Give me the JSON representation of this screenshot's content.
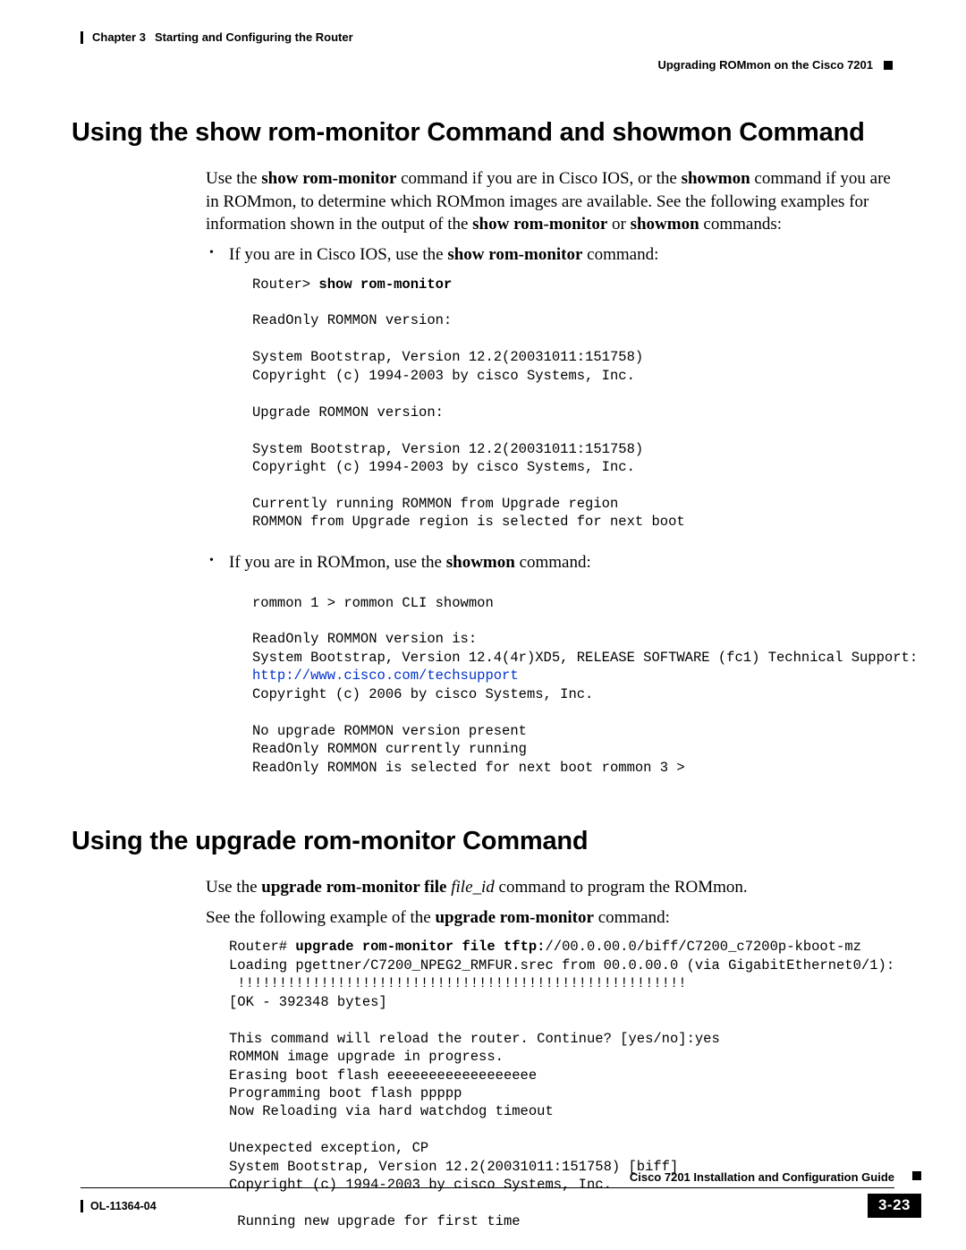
{
  "header": {
    "chapter_label": "Chapter 3",
    "chapter_title": "Starting and Configuring the Router",
    "section_right": "Upgrading ROMmon on the Cisco 7201"
  },
  "section1": {
    "title": "Using the show rom-monitor Command and showmon Command",
    "intro_pre": "Use the ",
    "intro_cmd1": "show rom-monitor",
    "intro_mid1": " command if you are in Cisco IOS, or the ",
    "intro_cmd2": "showmon",
    "intro_mid2": " command if you are in ROMmon, to determine which ROMmon images are available. See the following examples for information shown in the output of the ",
    "intro_cmd3": "show rom-monitor",
    "intro_mid3": " or ",
    "intro_cmd4": "showmon",
    "intro_tail": " commands:",
    "bullet1_pre": "If you are in Cisco IOS, use the ",
    "bullet1_cmd": "show rom-monitor",
    "bullet1_tail": " command:",
    "code1_prompt": "Router> ",
    "code1_cmd": "show rom-monitor",
    "code1_body": "\n\nReadOnly ROMMON version:\n\nSystem Bootstrap, Version 12.2(20031011:151758)\nCopyright (c) 1994-2003 by cisco Systems, Inc.\n\nUpgrade ROMMON version:\n\nSystem Bootstrap, Version 12.2(20031011:151758)\nCopyright (c) 1994-2003 by cisco Systems, Inc.\n\nCurrently running ROMMON from Upgrade region\nROMMON from Upgrade region is selected for next boot",
    "bullet2_pre": "If you are in ROMmon, use the ",
    "bullet2_cmd": "showmon",
    "bullet2_tail": " command:",
    "code2_top": "rommon 1 > rommon CLI showmon\n\nReadOnly ROMMON version is:\nSystem Bootstrap, Version 12.4(4r)XD5, RELEASE SOFTWARE (fc1) Technical Support: ",
    "code2_link": "http://www.cisco.com/techsupport",
    "code2_rest": "\nCopyright (c) 2006 by cisco Systems, Inc.\n\nNo upgrade ROMMON version present\nReadOnly ROMMON currently running\nReadOnly ROMMON is selected for next boot rommon 3 >"
  },
  "section2": {
    "title": "Using the upgrade rom-monitor Command",
    "p1_pre": "Use the ",
    "p1_cmd": "upgrade rom-monitor file",
    "p1_mid": " ",
    "p1_ital": "file_id",
    "p1_tail": " command to program the ROMmon.",
    "p2_pre": "See the following example of the ",
    "p2_cmd": "upgrade rom-monitor",
    "p2_tail": " command:",
    "code_prompt": "Router# ",
    "code_bold": "upgrade rom-monitor file tftp:",
    "code_rest": "//00.0.00.0/biff/C7200_c7200p-kboot-mz\nLoading pgettner/C7200_NPEG2_RMFUR.srec from 00.0.00.0 (via GigabitEthernet0/1):\n !!!!!!!!!!!!!!!!!!!!!!!!!!!!!!!!!!!!!!!!!!!!!!!!!!!!!!\n[OK - 392348 bytes]\n\nThis command will reload the router. Continue? [yes/no]:yes\nROMMON image upgrade in progress.\nErasing boot flash eeeeeeeeeeeeeeeeee\nProgramming boot flash ppppp\nNow Reloading via hard watchdog timeout\n\nUnexpected exception, CP\nSystem Bootstrap, Version 12.2(20031011:151758) [biff]\nCopyright (c) 1994-2003 by cisco Systems, Inc.\n\n Running new upgrade for first time"
  },
  "footer": {
    "guide": "Cisco 7201 Installation and Configuration Guide",
    "doc_id": "OL-11364-04",
    "page": "3-23"
  }
}
